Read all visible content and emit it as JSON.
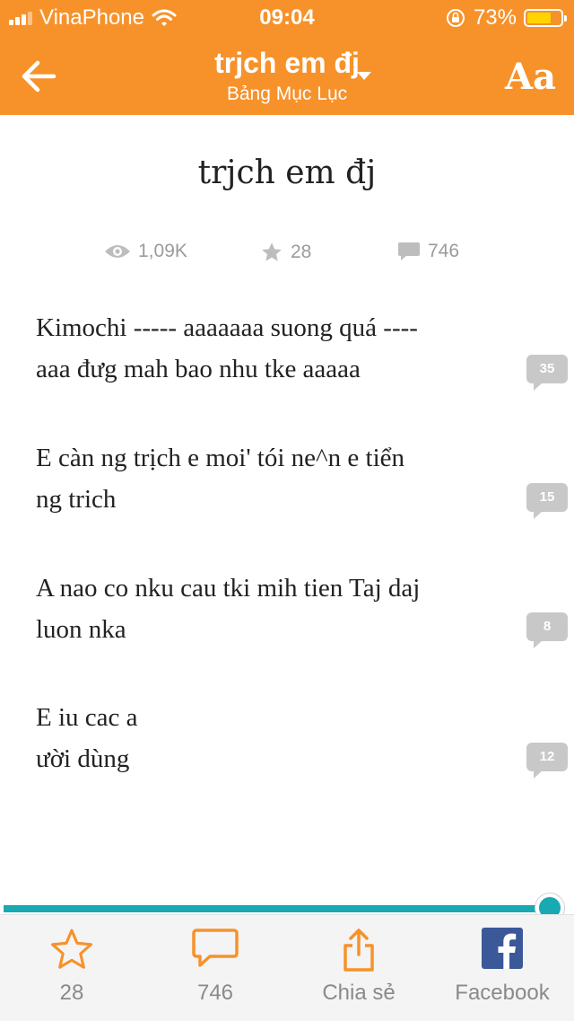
{
  "status_bar": {
    "carrier": "VinaPhone",
    "time": "09:04",
    "battery": "73%",
    "battery_level": 0.73
  },
  "header": {
    "title": "trjch em đj",
    "subtitle": "Bảng Mục Lục",
    "font_button": "Aa"
  },
  "chapter": {
    "title": "trjch em đj",
    "views": "1,09K",
    "votes": "28",
    "comments": "746"
  },
  "paragraphs": [
    {
      "line1": "Kimochi ----- aaaaaaa suong quá ----",
      "line2": "aaa đưg mah bao nhu tke aaaaa",
      "comments": "35"
    },
    {
      "line1": "E càn ng trịch e moi' tói ne^n e tiển",
      "line2": "ng trich",
      "comments": "15"
    },
    {
      "line1": "A nao co nku cau tki mih tien Taj daj",
      "line2": "luon nka",
      "comments": "8"
    },
    {
      "line1": "E iu cac a",
      "line2": "ười dùng",
      "comments": "12"
    }
  ],
  "reading_progress": 0.96,
  "toolbar": {
    "vote_count": "28",
    "comment_count": "746",
    "share_label": "Chia sẻ",
    "facebook_label": "Facebook"
  },
  "colors": {
    "accent": "#f7922a",
    "progress": "#19a9b3",
    "facebook": "#3b5998"
  }
}
